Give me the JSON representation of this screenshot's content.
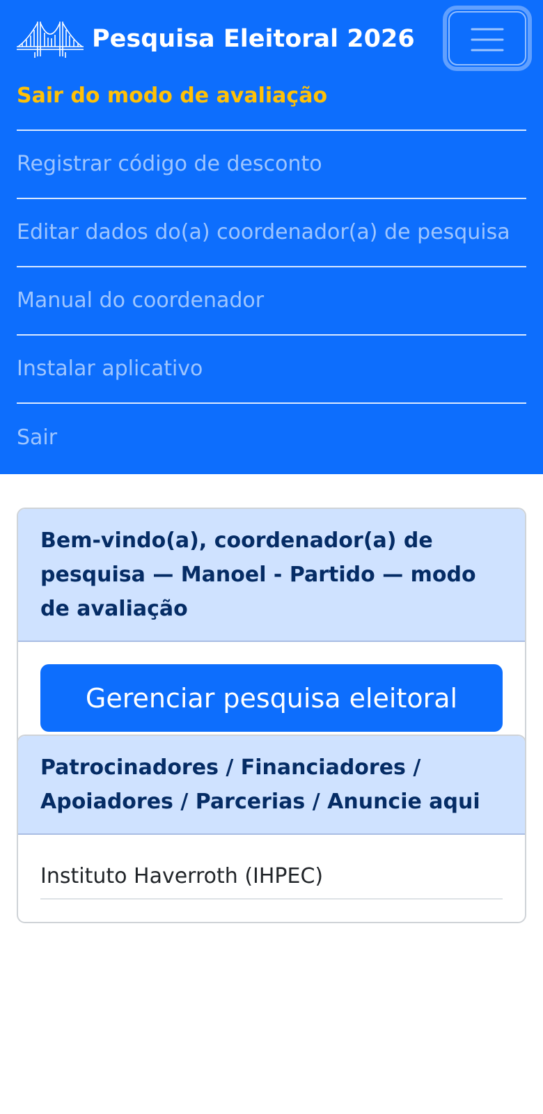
{
  "header": {
    "title": "Pesquisa Eleitoral 2026",
    "logo_icon": "bridge-icon",
    "toggler_icon": "hamburger-icon"
  },
  "menu": {
    "items": [
      {
        "label": "Sair do modo de avaliação",
        "highlight": true
      },
      {
        "label": "Registrar código de desconto"
      },
      {
        "label": "Editar dados do(a) coordenador(a) de pesquisa"
      },
      {
        "label": "Manual do coordenador"
      },
      {
        "label": "Instalar aplicativo"
      },
      {
        "label": "Sair"
      }
    ]
  },
  "welcome_card": {
    "header": "Bem-vindo(a), coordenador(a) de pesquisa — Manoel - Partido — modo de avaliação",
    "button_label": "Gerenciar pesquisa eleitoral"
  },
  "sponsors_card": {
    "header": "Patrocinadores / Financiadores / Apoiadores / Parcerias / Anuncie aqui",
    "items": [
      "Instituto Haverroth (IHPEC)"
    ]
  },
  "colors": {
    "primary": "#0d6efd",
    "highlight": "#ffc107",
    "card_header_bg": "#cfe2ff",
    "card_header_text": "#052c65"
  }
}
